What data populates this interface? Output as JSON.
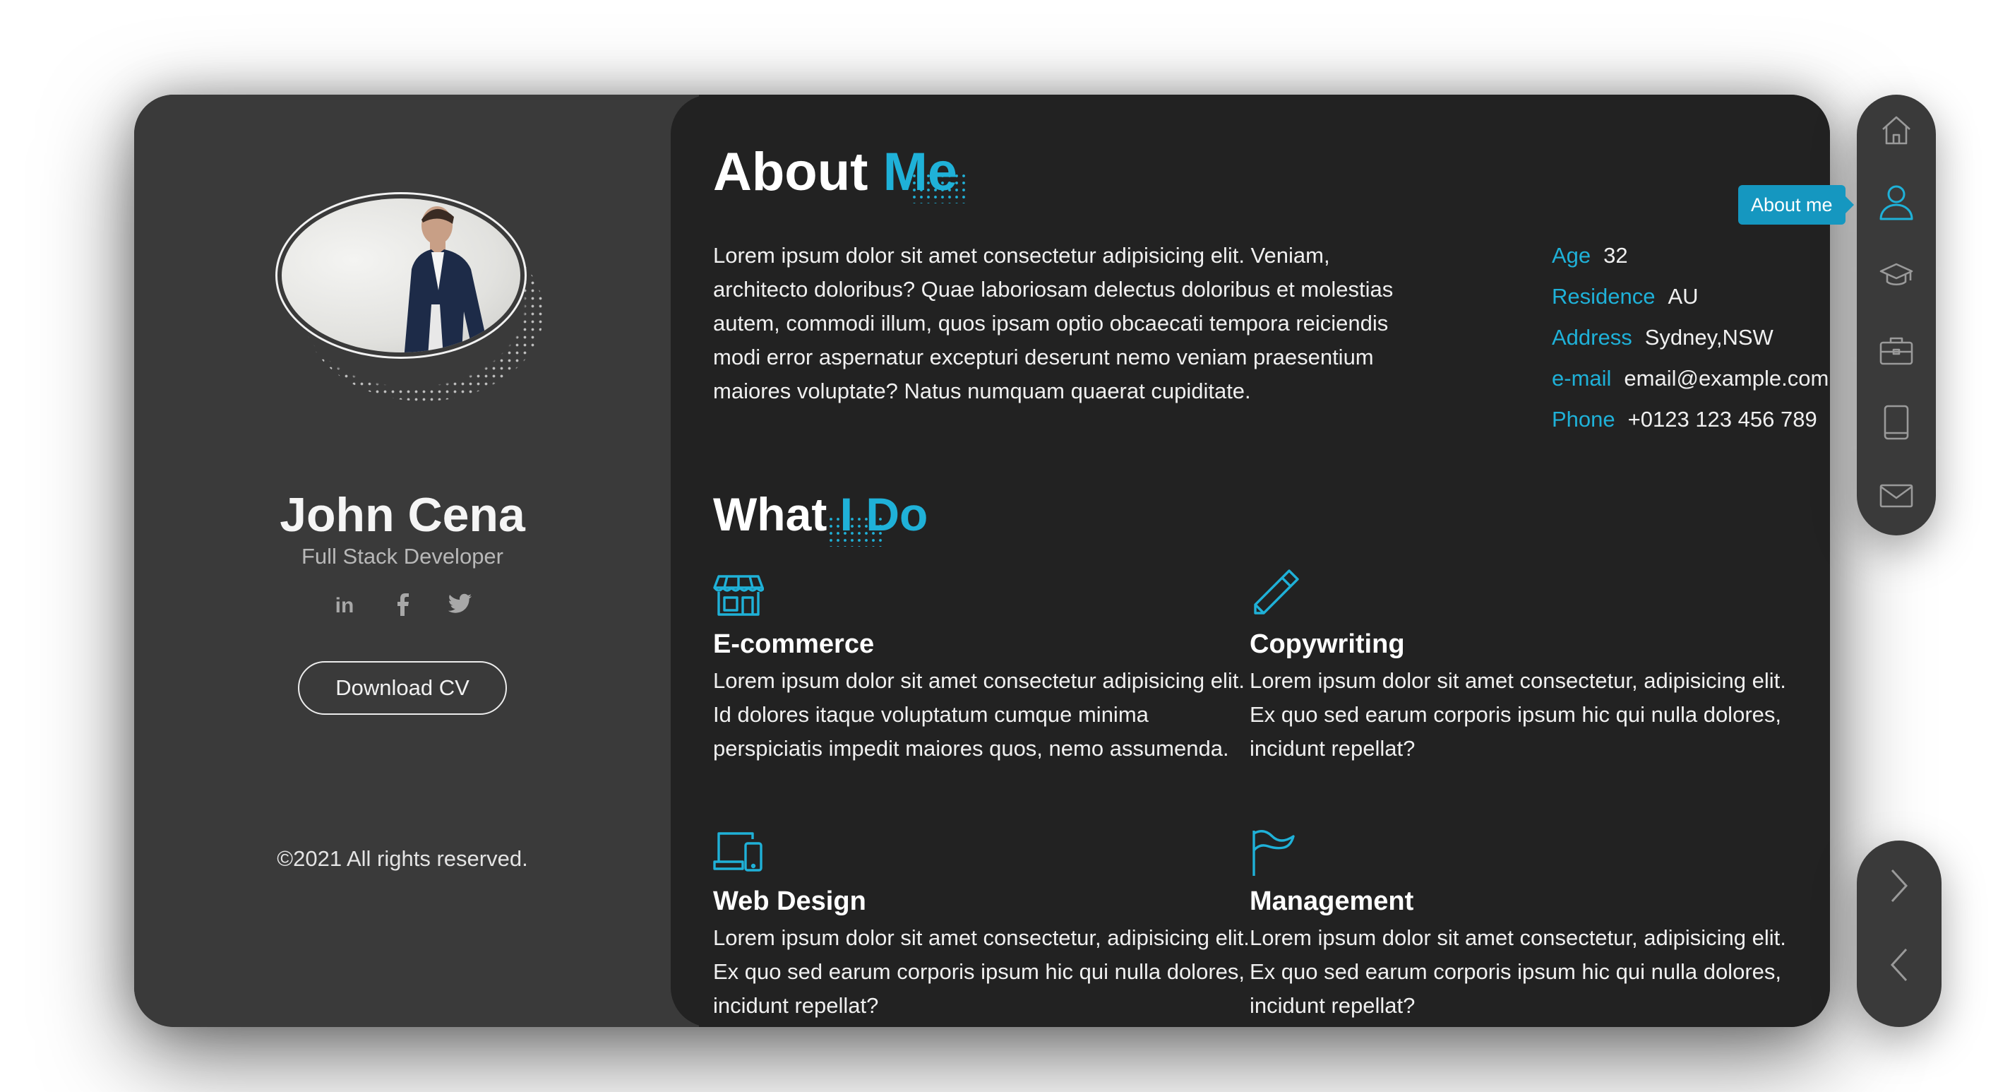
{
  "profile": {
    "name": "John Cena",
    "role": "Full Stack Developer",
    "socials": [
      {
        "icon": "linkedin-icon",
        "glyph": "in"
      },
      {
        "icon": "facebook-icon",
        "glyph": "f"
      },
      {
        "icon": "twitter-icon",
        "glyph": "twitter"
      }
    ],
    "download_label": "Download CV",
    "copyright": "©2021 All rights reserved."
  },
  "about": {
    "title_main": "About ",
    "title_accent": "Me",
    "text": "Lorem ipsum dolor sit amet consectetur adipisicing elit. Veniam, architecto doloribus? Quae laboriosam delectus doloribus et molestias autem, commodi illum, quos ipsam optio obcaecati tempora reiciendis modi error aspernatur excepturi deserunt nemo veniam praesentium maiores voluptate? Natus numquam quaerat cupiditate.",
    "info": [
      {
        "key": "Age",
        "value": "32"
      },
      {
        "key": "Residence",
        "value": "AU"
      },
      {
        "key": "Address",
        "value": "Sydney,NSW"
      },
      {
        "key": "e-mail",
        "value": "email@example.com"
      },
      {
        "key": "Phone",
        "value": "+0123 123 456 789"
      }
    ]
  },
  "services": {
    "title_main": "What ",
    "title_accent": "I Do",
    "items": [
      {
        "icon": "store-icon",
        "title": "E-commerce",
        "text": "Lorem ipsum dolor sit amet consectetur adipisicing elit. Id dolores itaque voluptatum cumque minima perspiciatis impedit maiores quos, nemo assumenda."
      },
      {
        "icon": "pencil-icon",
        "title": "Copywriting",
        "text": "Lorem ipsum dolor sit amet consectetur, adipisicing elit. Ex quo sed earum corporis ipsum hic qui nulla dolores, incidunt repellat?"
      },
      {
        "icon": "devices-icon",
        "title": "Web Design",
        "text": "Lorem ipsum dolor sit amet consectetur, adipisicing elit. Ex quo sed earum corporis ipsum hic qui nulla dolores, incidunt repellat?"
      },
      {
        "icon": "flag-icon",
        "title": "Management",
        "text": "Lorem ipsum dolor sit amet consectetur, adipisicing elit. Ex quo sed earum corporis ipsum hic qui nulla dolores, incidunt repellat?"
      }
    ]
  },
  "nav": {
    "tooltip": "About me",
    "items": [
      "home-icon",
      "user-icon",
      "graduation-cap-icon",
      "briefcase-icon",
      "tablet-icon",
      "envelope-icon"
    ],
    "active": "user-icon"
  },
  "pager": [
    "next-arrow-icon",
    "prev-arrow-icon"
  ],
  "colors": {
    "accent": "#1fb1d8",
    "sidebar_bg": "#3a3a3a",
    "content_bg": "#222222",
    "tooltip_bg": "#1597c0"
  }
}
